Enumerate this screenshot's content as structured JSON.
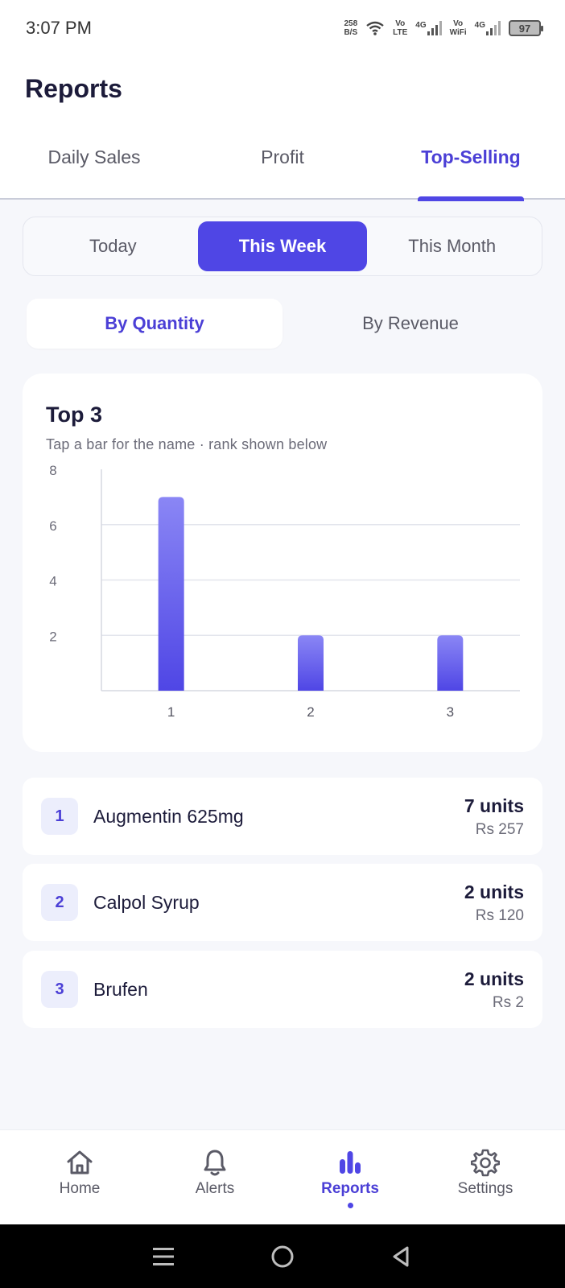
{
  "status_bar": {
    "time": "3:07 PM",
    "net_speed_value": "258",
    "net_speed_unit": "B/S",
    "volte_top": "Vo",
    "volte_bottom": "LTE",
    "sim1_type": "4G",
    "vowifi_top": "Vo",
    "vowifi_bottom": "WiFi",
    "sim2_type": "4G",
    "battery": "97"
  },
  "header": {
    "title": "Reports",
    "tabs": [
      {
        "label": "Daily Sales"
      },
      {
        "label": "Profit"
      },
      {
        "label": "Top-Selling"
      }
    ]
  },
  "period": {
    "options": [
      {
        "label": "Today"
      },
      {
        "label": "This Week"
      },
      {
        "label": "This Month"
      }
    ]
  },
  "measure": {
    "options": [
      {
        "label": "By Quantity"
      },
      {
        "label": "By Revenue"
      }
    ]
  },
  "chart_card": {
    "title": "Top 3",
    "subtitle": "Tap a bar for the name · rank shown below"
  },
  "chart_data": {
    "type": "bar",
    "categories": [
      "1",
      "2",
      "3"
    ],
    "values": [
      7,
      2,
      2
    ],
    "y_ticks": [
      "2",
      "4",
      "6",
      "8"
    ],
    "ylim": [
      0,
      8
    ],
    "grid": true,
    "bar_color_top": "#8a86f5",
    "bar_color_bottom": "#4f46e5"
  },
  "ranking": [
    {
      "rank": "1",
      "name": "Augmentin 625mg",
      "units": "7 units",
      "revenue": "Rs 257"
    },
    {
      "rank": "2",
      "name": "Calpol Syrup",
      "units": "2 units",
      "revenue": "Rs 120"
    },
    {
      "rank": "3",
      "name": "Brufen",
      "units": "2 units",
      "revenue": "Rs 2"
    }
  ],
  "bottom_nav": {
    "items": [
      {
        "label": "Home",
        "icon": "home-icon"
      },
      {
        "label": "Alerts",
        "icon": "bell-icon"
      },
      {
        "label": "Reports",
        "icon": "bar-chart-icon"
      },
      {
        "label": "Settings",
        "icon": "gear-icon"
      }
    ]
  },
  "colors": {
    "accent": "#4f46e5",
    "accent_text": "#4b3fd6",
    "background": "#f6f7fb",
    "text_primary": "#1c1b3a",
    "text_secondary": "#5a5a66"
  }
}
